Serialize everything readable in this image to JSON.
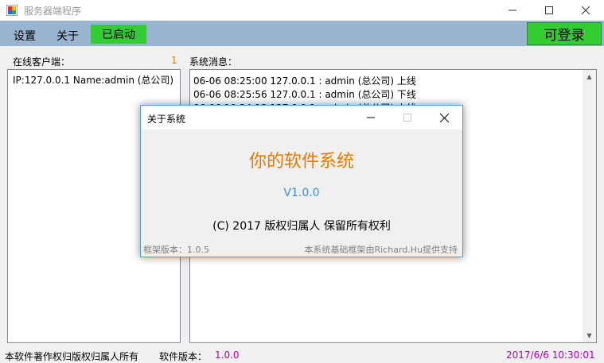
{
  "window": {
    "title": "服务器端程序"
  },
  "menu": {
    "settings": "设置",
    "about": "关于",
    "status": "已启动",
    "login_button": "可登录"
  },
  "clients": {
    "label": "在线客户端：",
    "count": "1",
    "items": [
      "IP:127.0.0.1 Name:admin (总公司)"
    ]
  },
  "messages": {
    "label": "系统消息：",
    "items": [
      "06-06 08:25:00 127.0.0.1 : admin (总公司) 上线",
      "06-06 08:25:56 127.0.0.1 : admin (总公司) 下线",
      "06-06 10:24:13 127.0.0.1 : admin (总公司) 上线"
    ]
  },
  "statusbar": {
    "copyright": "本软件著作权归版权归属人所有",
    "version_label": "软件版本：",
    "version_value": "1.0.0",
    "datetime": "2017/6/6 10:30:01"
  },
  "about_dialog": {
    "title": "关于系统",
    "product_name": "你的软件系统",
    "version": "V1.0.0",
    "copyright": "(C) 2017 版权归属人 保留所有权利",
    "framework_version": "框架版本：1.0.5",
    "support": "本系统基础框架由Richard.Hu提供支持"
  },
  "colors": {
    "menubar": "#99b4d1",
    "status_green": "#33cc33",
    "accent_orange": "#e87a00",
    "version_blue": "#3a8fd4",
    "status_magenta": "#b000b0"
  }
}
